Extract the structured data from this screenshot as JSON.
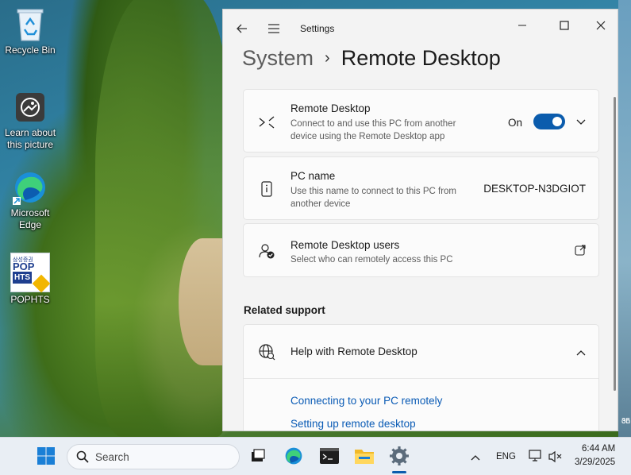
{
  "desktop": {
    "icons": [
      {
        "label_line1": "Recycle Bin",
        "label_line2": ""
      },
      {
        "label_line1": "Learn about",
        "label_line2": "this picture"
      },
      {
        "label_line1": "Microsoft",
        "label_line2": "Edge"
      },
      {
        "label_line1": "POPHTS",
        "label_line2": ""
      }
    ],
    "pophts_logo_text": [
      "삼성증권",
      "POP",
      "HTS"
    ],
    "right_edge_text": [
      "on",
      "35"
    ]
  },
  "window": {
    "title": "Settings",
    "breadcrumb_parent": "System",
    "breadcrumb_separator": "›",
    "breadcrumb_current": "Remote Desktop",
    "cards": {
      "remote_desktop": {
        "title": "Remote Desktop",
        "desc": "Connect to and use this PC from another device using the Remote Desktop app",
        "toggle_label": "On",
        "toggle_state": true
      },
      "pc_name": {
        "title": "PC name",
        "desc": "Use this name to connect to this PC from another device",
        "value": "DESKTOP-N3DGIOT"
      },
      "users": {
        "title": "Remote Desktop users",
        "desc": "Select who can remotely access this PC"
      }
    },
    "related_support": {
      "heading": "Related support",
      "help_title": "Help with Remote Desktop",
      "links": [
        "Connecting to your PC remotely",
        "Setting up remote desktop"
      ]
    }
  },
  "taskbar": {
    "search_placeholder": "Search",
    "language": "ENG",
    "time": "6:44 AM",
    "date": "3/29/2025"
  },
  "colors": {
    "accent": "#0b5cad",
    "link": "#0a5bb5",
    "window_bg": "#f3f3f3",
    "card_bg": "#fbfbfb"
  }
}
